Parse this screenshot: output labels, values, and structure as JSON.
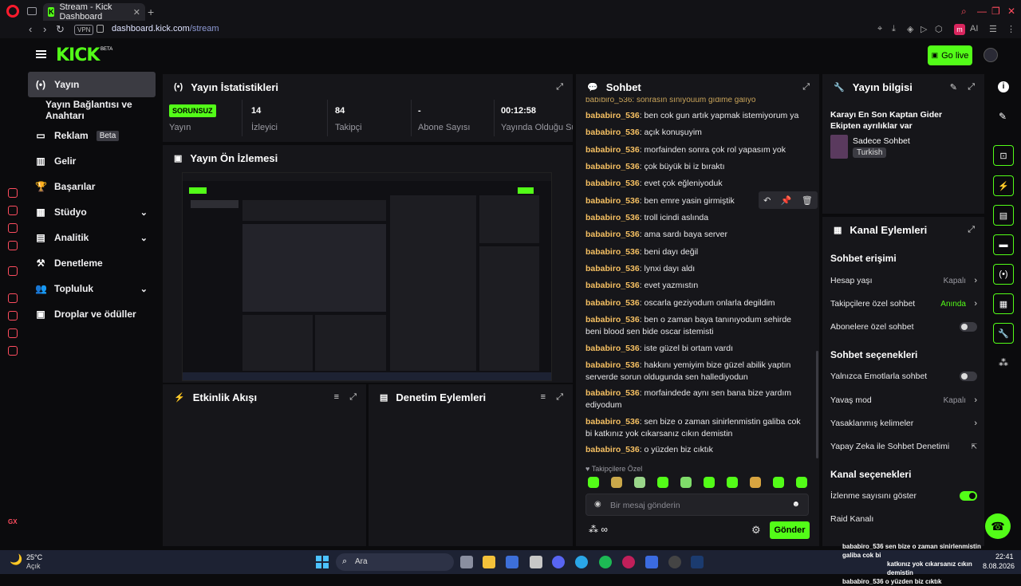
{
  "browser": {
    "tab_title": "Stream - Kick Dashboard",
    "tab_favicon": "K",
    "url_domain": "dashboard.kick.com",
    "url_path": "/stream",
    "vpn_label": "VPN",
    "ai_label": "AI",
    "profile_letter": "m"
  },
  "header": {
    "logo": "KICK",
    "logo_beta": "BETA",
    "go_live": "Go live"
  },
  "nav": {
    "items": [
      {
        "label": "Yayın",
        "icon": "(•)"
      },
      {
        "label": "Yayın Bağlantısı ve Anahtarı",
        "icon": ""
      },
      {
        "label": "Reklam",
        "icon": "▭",
        "badge": "Beta"
      },
      {
        "label": "Gelir",
        "icon": "▥"
      },
      {
        "label": "Başarılar",
        "icon": "🏆"
      },
      {
        "label": "Stüdyo",
        "icon": "▦",
        "chevron": "⌄"
      },
      {
        "label": "Analitik",
        "icon": "▤",
        "chevron": "⌄"
      },
      {
        "label": "Denetleme",
        "icon": "⚒"
      },
      {
        "label": "Topluluk",
        "icon": "👥",
        "chevron": "⌄"
      },
      {
        "label": "Droplar ve ödüller",
        "icon": "▣"
      }
    ]
  },
  "stats": {
    "title": "Yayın İstatistikleri",
    "status_badge": "SORUNSUZ",
    "cells": [
      {
        "label": "Yayın"
      },
      {
        "value": "14",
        "label": "İzleyici"
      },
      {
        "value": "84",
        "label": "Takipçi"
      },
      {
        "value": "-",
        "label": "Abone Sayısı"
      },
      {
        "value": "00:12:58",
        "label": "Yayında Olduğu Süre"
      }
    ]
  },
  "preview": {
    "title": "Yayın Ön İzlemesi"
  },
  "activity": {
    "title": "Etkinlik Akışı"
  },
  "moderation": {
    "title": "Denetim Eylemleri"
  },
  "chat": {
    "title": "Sohbet",
    "top_partial": "babıbiro_536: sonrasın sınıyouum gıdime galıyo",
    "messages": [
      {
        "user": "bababiro_536",
        "text": "ben cok gun artık yapmak istemiyorum ya"
      },
      {
        "user": "bababiro_536",
        "text": "açık konuşuyim"
      },
      {
        "user": "bababiro_536",
        "text": "morfainden sonra çok rol yapasım yok"
      },
      {
        "user": "bababiro_536",
        "text": "çok büyük bi iz bıraktı"
      },
      {
        "user": "bababiro_536",
        "text": "evet çok eğleniyoduk"
      },
      {
        "user": "bababiro_536",
        "text": "ben emre yasin girmiştik"
      },
      {
        "user": "bababiro_536",
        "text": "troll icindi aslında"
      },
      {
        "user": "bababiro_536",
        "text": "ama sardı baya server"
      },
      {
        "user": "bababiro_536",
        "text": "beni dayı değil"
      },
      {
        "user": "bababiro_536",
        "text": "lynxi dayı aldı"
      },
      {
        "user": "bababiro_536",
        "text": "evet yazmıstın"
      },
      {
        "user": "bababiro_536",
        "text": "oscarla geziyodum onlarla degildim"
      },
      {
        "user": "bababiro_536",
        "text": "ben o zaman baya tanınıyodum sehirde beni blood sen bide oscar istemisti"
      },
      {
        "user": "bababiro_536",
        "text": "iste güzel bi ortam vardı"
      },
      {
        "user": "bababiro_536",
        "text": "hakkını yemiyim bize güzel abilik yaptın serverde sorun oldugunda sen hallediyodun"
      },
      {
        "user": "bababiro_536",
        "text": "morfaindede aynı sen bana bize yardım ediyodum"
      },
      {
        "user": "bababiro_536",
        "text": "sen bize o zaman sinirlenmistin galiba cok bi katkınız yok cıkarsanız cıkın demistin"
      },
      {
        "user": "bababiro_536",
        "text": "o yüzden biz cıktık"
      }
    ],
    "followers_only": "Takipçilere Özel",
    "input_placeholder": "Bir mesaj gönderin",
    "send": "Gönder"
  },
  "stream_info": {
    "title": "Yayın bilgisi",
    "stream_title": "Karayı En Son Kaptan Gider Ekipten ayrılıklar var",
    "category": "Sadece Sohbet",
    "language": "Turkish"
  },
  "channel_actions": {
    "title": "Kanal Eylemleri",
    "chat_access_title": "Sohbet erişimi",
    "account_age": "Hesap yaşı",
    "account_age_value": "Kapalı",
    "followers_chat": "Takipçilere özel sohbet",
    "followers_chat_value": "Anında",
    "subs_chat": "Abonelere özel sohbet",
    "chat_options_title": "Sohbet seçenekleri",
    "emote_only": "Yalnızca Emotlarla sohbet",
    "slow_mode": "Yavaş mod",
    "slow_mode_value": "Kapalı",
    "banned_words": "Yasaklanmış kelimeler",
    "ai_moderation": "Yapay Zeka ile Sohbet Denetimi",
    "channel_options_title": "Kanal seçenekleri",
    "show_viewers": "İzlenme sayısını göster",
    "raid_channel": "Raid Kanalı"
  },
  "taskbar": {
    "weather_temp": "25°C",
    "weather_desc": "Açık",
    "search": "Ara",
    "time": "22:41",
    "date": "8.08.2026",
    "notification_line1": "bababiro_536 sen bize o zaman sinirlenmistin galiba cok bi",
    "notification_line2": "katkınız yok cıkarsanız cıkın demistin",
    "notification_line3": "bababiro_536 o yüzden biz cıktık"
  },
  "colors": {
    "accent": "#53fc18",
    "username": "#f6c062",
    "opera_red": "#ff1b2d",
    "panel_bg": "#16161a"
  }
}
